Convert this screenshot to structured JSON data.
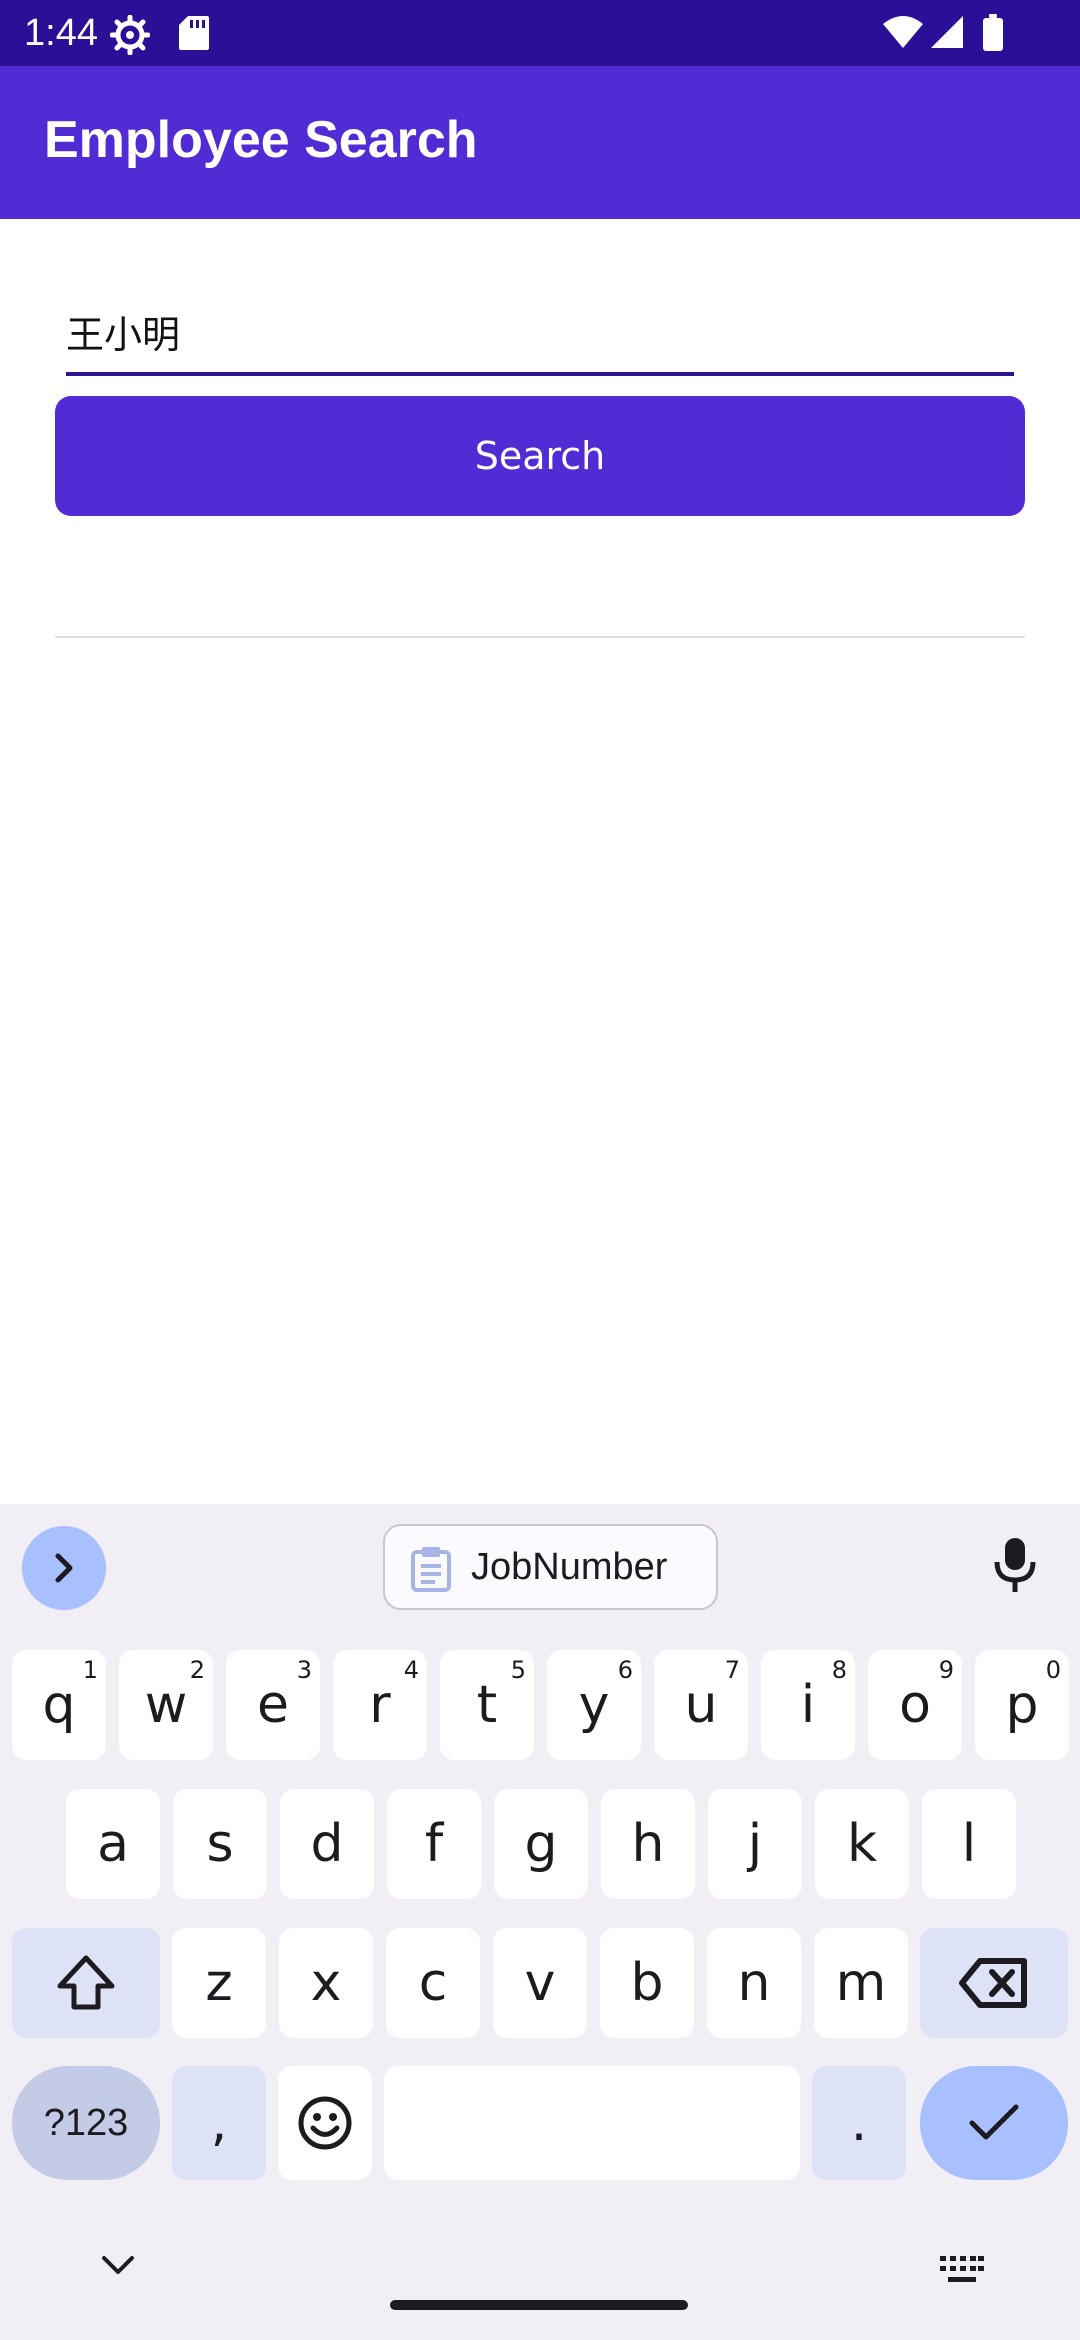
{
  "status_bar": {
    "time": "1:44",
    "icons_left": [
      "settings-gear-icon",
      "sd-card-icon"
    ],
    "icons_right": [
      "wifi-icon",
      "cellular-signal-icon",
      "battery-icon"
    ]
  },
  "app_bar": {
    "title": "Employee Search"
  },
  "search": {
    "input_value": "王小明",
    "button_label": "Search"
  },
  "keyboard": {
    "suggestion": "JobNumber",
    "rows": [
      [
        {
          "label": "q",
          "hint": "1"
        },
        {
          "label": "w",
          "hint": "2"
        },
        {
          "label": "e",
          "hint": "3"
        },
        {
          "label": "r",
          "hint": "4"
        },
        {
          "label": "t",
          "hint": "5"
        },
        {
          "label": "y",
          "hint": "6"
        },
        {
          "label": "u",
          "hint": "7"
        },
        {
          "label": "i",
          "hint": "8"
        },
        {
          "label": "o",
          "hint": "9"
        },
        {
          "label": "p",
          "hint": "0"
        }
      ],
      [
        {
          "label": "a"
        },
        {
          "label": "s"
        },
        {
          "label": "d"
        },
        {
          "label": "f"
        },
        {
          "label": "g"
        },
        {
          "label": "h"
        },
        {
          "label": "j"
        },
        {
          "label": "k"
        },
        {
          "label": "l"
        }
      ],
      [
        {
          "label": "z"
        },
        {
          "label": "x"
        },
        {
          "label": "c"
        },
        {
          "label": "v"
        },
        {
          "label": "b"
        },
        {
          "label": "n"
        },
        {
          "label": "m"
        }
      ]
    ],
    "symbols_label": "?123",
    "comma_label": ",",
    "period_label": "."
  },
  "colors": {
    "status_bar": "#2c0f97",
    "primary": "#512bd4",
    "keyboard_bg": "#f1eff5",
    "enter_key": "#a8c0ff"
  }
}
